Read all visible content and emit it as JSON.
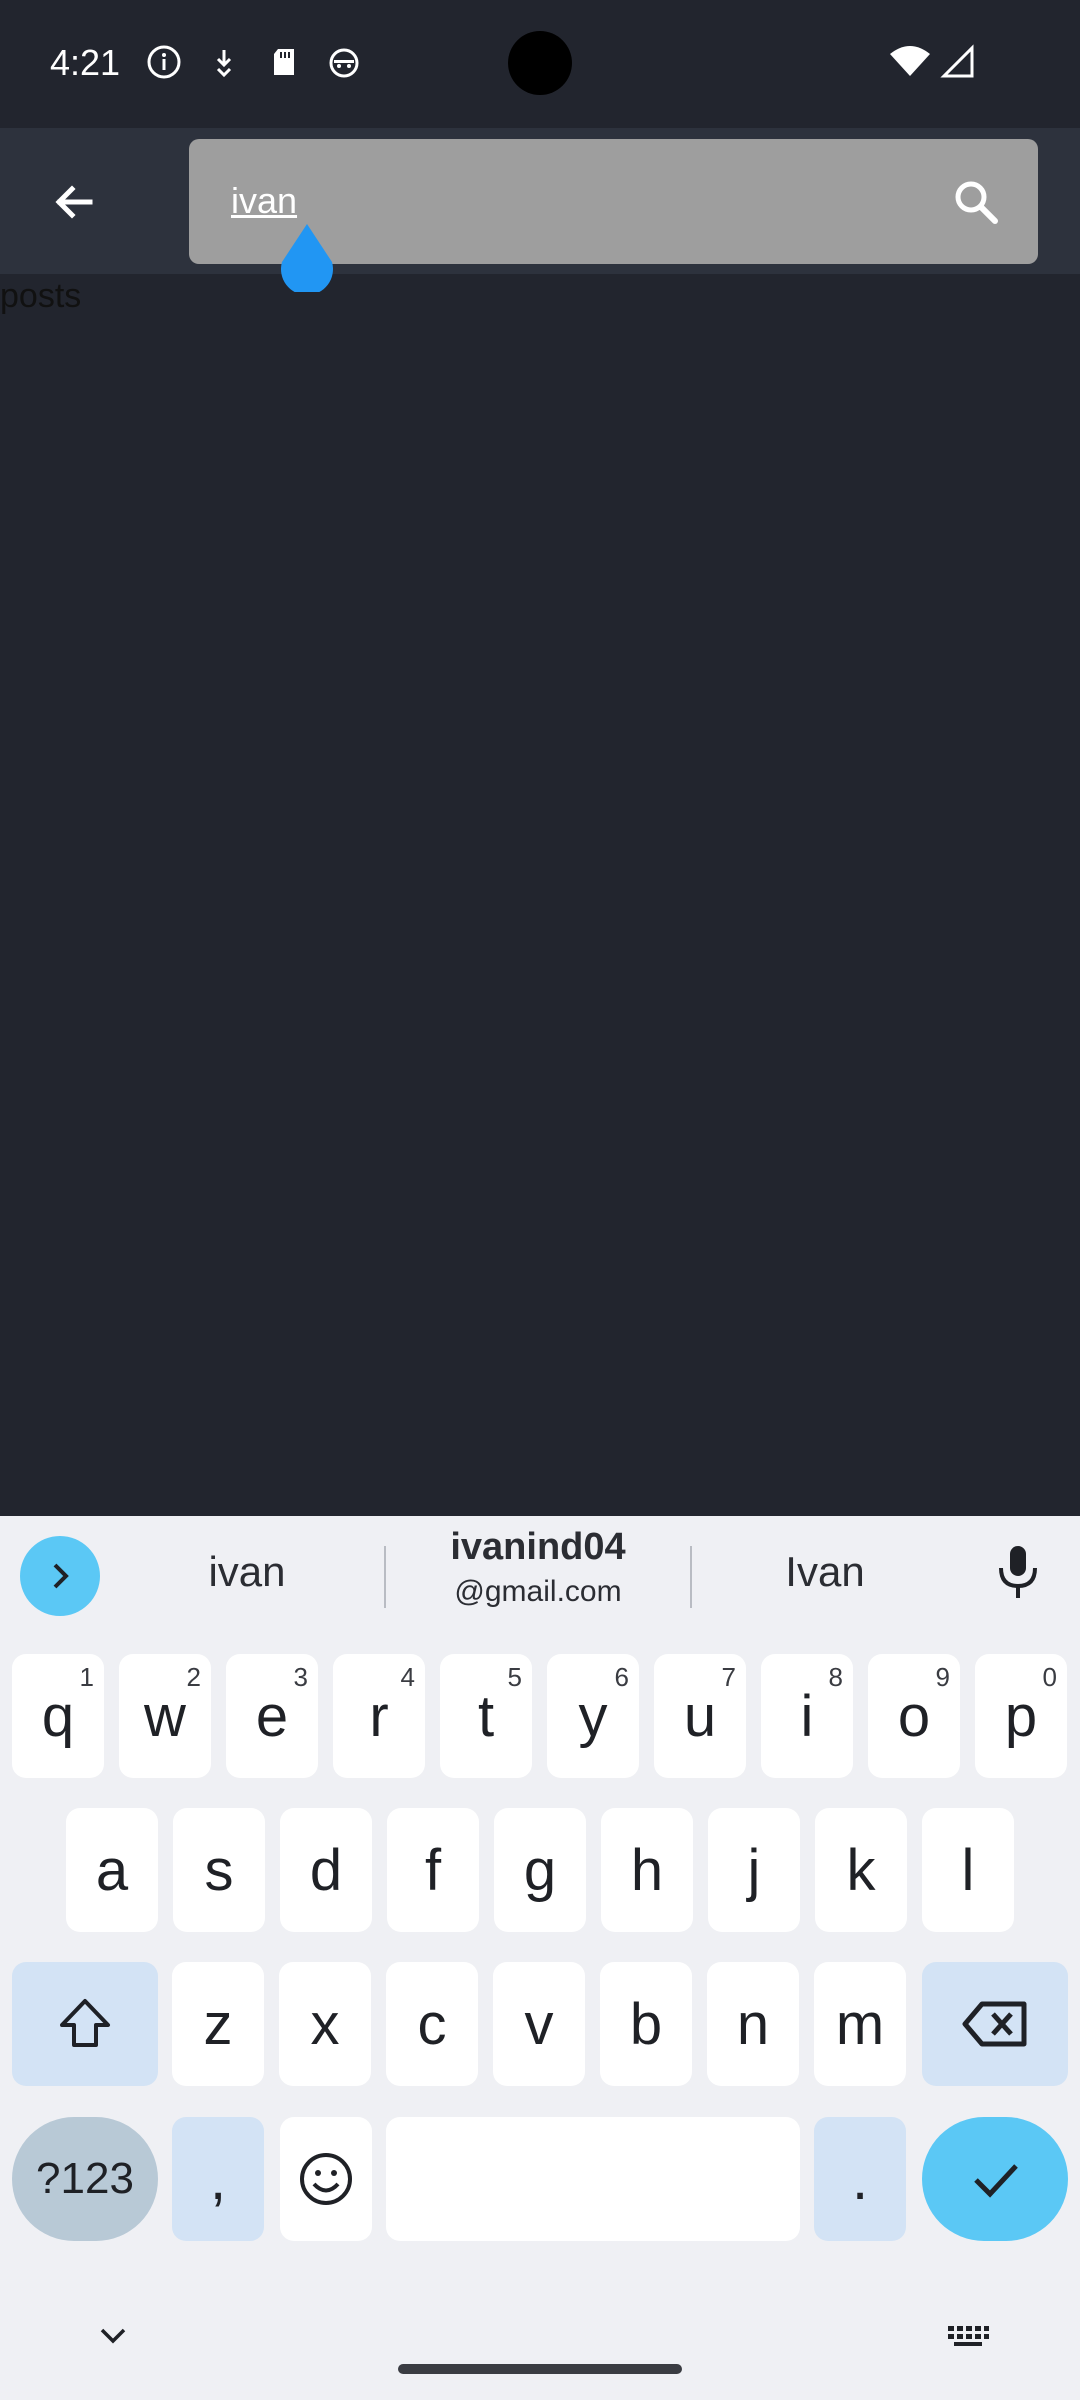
{
  "status_bar": {
    "time": "4:21",
    "icons_left": [
      "info-icon",
      "download-notification-icon",
      "sd-card-icon",
      "cat-face-icon"
    ],
    "icons_right": [
      "wifi-icon",
      "cellular-signal-icon"
    ]
  },
  "search_bar": {
    "query": "ivan",
    "back_icon": "arrow-left-icon",
    "search_icon": "magnifier-icon"
  },
  "content": {
    "label": "posts"
  },
  "keyboard": {
    "suggestions": {
      "left": "ivan",
      "center_main": "ivanind04",
      "center_sub": "@gmail.com",
      "right": "Ivan"
    },
    "row1": [
      {
        "key": "q",
        "hint": "1"
      },
      {
        "key": "w",
        "hint": "2"
      },
      {
        "key": "e",
        "hint": "3"
      },
      {
        "key": "r",
        "hint": "4"
      },
      {
        "key": "t",
        "hint": "5"
      },
      {
        "key": "y",
        "hint": "6"
      },
      {
        "key": "u",
        "hint": "7"
      },
      {
        "key": "i",
        "hint": "8"
      },
      {
        "key": "o",
        "hint": "9"
      },
      {
        "key": "p",
        "hint": "0"
      }
    ],
    "row2": [
      "a",
      "s",
      "d",
      "f",
      "g",
      "h",
      "j",
      "k",
      "l"
    ],
    "row3": [
      "z",
      "x",
      "c",
      "v",
      "b",
      "n",
      "m"
    ],
    "symbols_label": "?123",
    "comma_label": ",",
    "period_label": ".",
    "space_label": ""
  },
  "colors": {
    "background": "#22252e",
    "app_bar": "#2d323d",
    "search_box": "#9e9e9e",
    "accent_blue": "#2196f3",
    "keyboard_accent": "#5bc8f5"
  }
}
